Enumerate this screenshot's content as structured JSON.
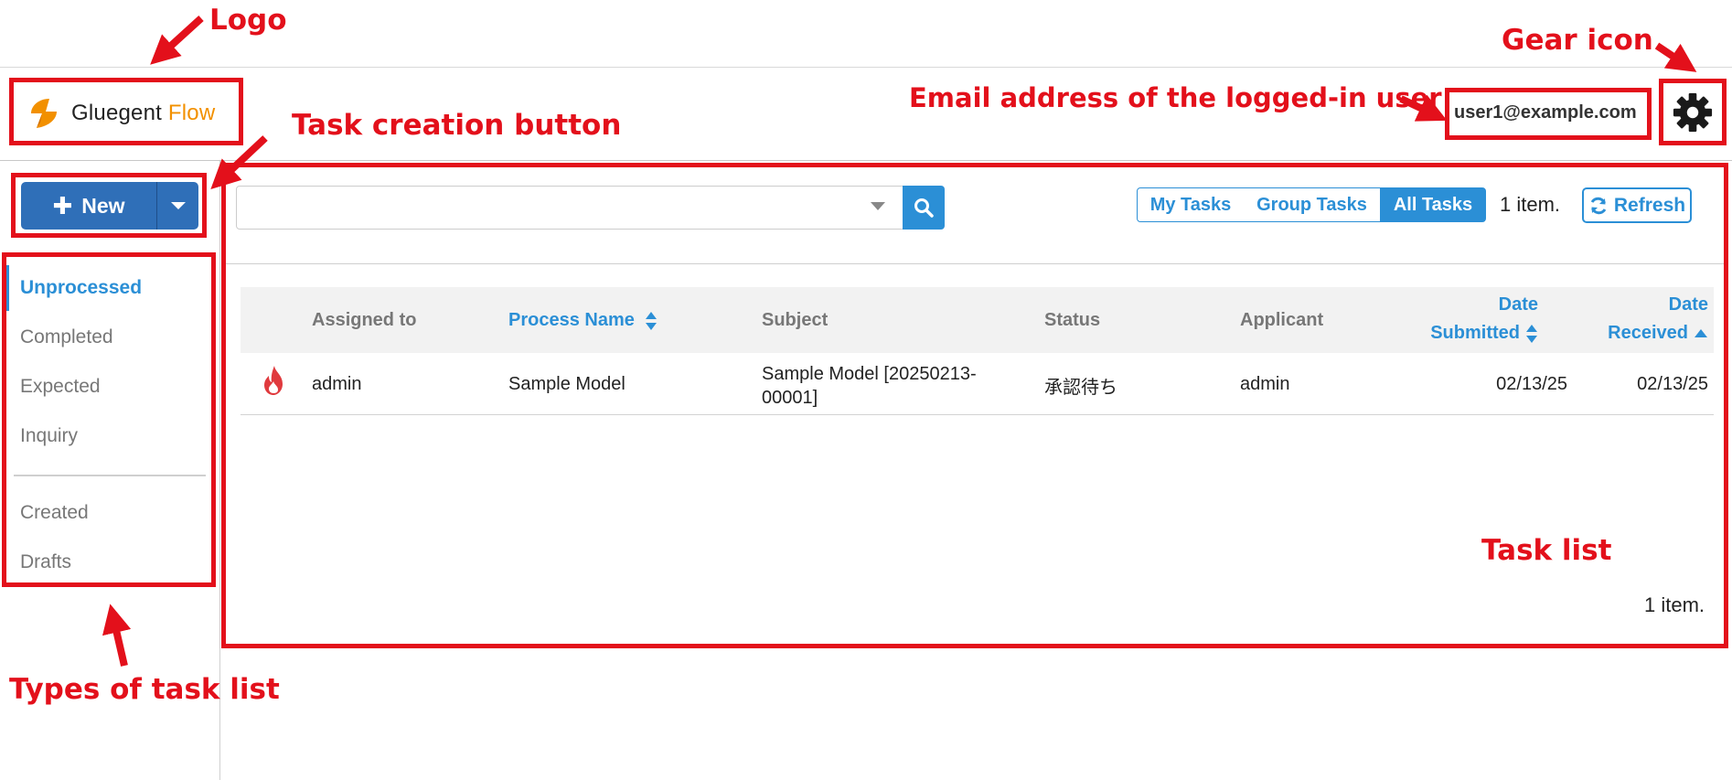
{
  "logo": {
    "brand": "Gluegent",
    "product": "Flow"
  },
  "header": {
    "user_email": "user1@example.com",
    "gear_icon": "gear-icon"
  },
  "new_button": {
    "label": "New",
    "icon": "plus-icon",
    "dropdown_icon": "caret-down-icon"
  },
  "sidebar": {
    "items": [
      {
        "label": "Unprocessed",
        "active": true
      },
      {
        "label": "Completed"
      },
      {
        "label": "Expected"
      },
      {
        "label": "Inquiry"
      },
      {
        "label": "Created"
      },
      {
        "label": "Drafts"
      }
    ]
  },
  "search": {
    "value": "",
    "placeholder": "",
    "icon": "search-icon"
  },
  "filters": {
    "tabs": [
      "My Tasks",
      "Group Tasks",
      "All Tasks"
    ],
    "selected": "All Tasks"
  },
  "item_count": "1 item.",
  "refresh": {
    "label": "Refresh",
    "icon": "refresh-icon"
  },
  "table": {
    "columns": {
      "assigned_to": "Assigned to",
      "process_name": "Process Name",
      "subject": "Subject",
      "status": "Status",
      "applicant": "Applicant",
      "date_submitted_1": "Date",
      "date_submitted_2": "Submitted",
      "date_received_1": "Date",
      "date_received_2": "Received"
    },
    "rows": [
      {
        "priority_icon": "fire-icon",
        "assigned_to": "admin",
        "process_name": "Sample Model",
        "subject_line1": "Sample Model [20250213-",
        "subject_line2": "00001]",
        "status": "承認待ち",
        "applicant": "admin",
        "date_submitted": "02/13/25",
        "date_received": "02/13/25"
      }
    ]
  },
  "footer_count": "1 item.",
  "annotations": {
    "logo": "Logo",
    "gear": "Gear icon",
    "email": "Email address of the logged-in user",
    "task_creation": "Task creation button",
    "task_list": "Task list",
    "types": "Types of task list"
  },
  "colors": {
    "accent": "#2b8fd6",
    "primary_button": "#2f6fb8",
    "annotation": "#e3101b",
    "brand_orange": "#f29000"
  }
}
